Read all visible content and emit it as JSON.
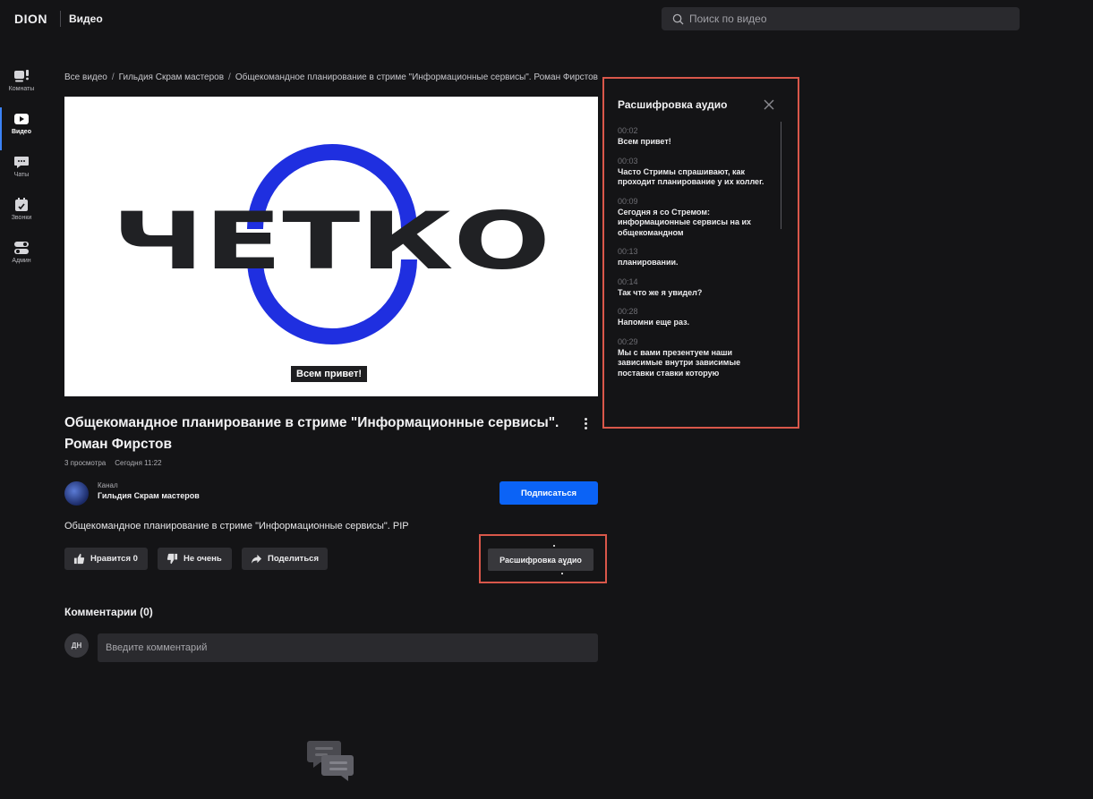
{
  "app": {
    "logo": "DION",
    "section": "Видео"
  },
  "search": {
    "placeholder": "Поиск по видео"
  },
  "sidebar": {
    "items": [
      {
        "label": "Комнаты",
        "icon": "rooms-icon"
      },
      {
        "label": "Видео",
        "icon": "video-icon",
        "active": true
      },
      {
        "label": "Чаты",
        "icon": "chat-icon"
      },
      {
        "label": "Звонки",
        "icon": "calls-icon"
      },
      {
        "label": "Админ",
        "icon": "admin-icon"
      }
    ]
  },
  "breadcrumbs": [
    "Все видео",
    "Гильдия Скрам мастеров",
    "Общекомандное планирование в стриме \"Информационные сервисы\". Роман Фирстов"
  ],
  "video": {
    "logo_text": "ЧЕТКО",
    "subtitle": "Всем привет!",
    "title": "Общекомандное планирование в стриме \"Информационные сервисы\". Роман Фирстов",
    "views": "3 просмотра",
    "date": "Сегодня 11:22",
    "description": "Общекомандное планирование в стриме \"Информационные сервисы\". PIP"
  },
  "channel": {
    "caption": "Канал",
    "name": "Гильдия Скрам мастеров",
    "subscribe_label": "Подписаться"
  },
  "actions": {
    "like_label": "Нравится 0",
    "dislike_label": "Не очень",
    "share_label": "Поделиться",
    "transcript_label": "Расшифровка аудио"
  },
  "comments": {
    "title": "Комментарии (0)",
    "user_initials": "ДН",
    "placeholder": "Введите комментарий"
  },
  "transcript": {
    "title": "Расшифровка аудио",
    "entries": [
      {
        "time": "00:02",
        "text": "Всем привет!"
      },
      {
        "time": "00:03",
        "text": "Часто Стримы спрашивают, как проходит планирование у их коллег."
      },
      {
        "time": "00:09",
        "text": "Сегодня я со Стремом: информационные сервисы на их общекомандном"
      },
      {
        "time": "00:13",
        "text": "планировании."
      },
      {
        "time": "00:14",
        "text": "Так что же я увидел?"
      },
      {
        "time": "00:28",
        "text": "Напомни еще раз."
      },
      {
        "time": "00:29",
        "text": "Мы с вами презентуем наши зависимые внутри зависимые поставки ставки которую"
      }
    ]
  },
  "colors": {
    "accent": "#0b63f6",
    "highlight": "#d9574a",
    "background": "#141416",
    "logo_blue": "#1f2fe0"
  }
}
